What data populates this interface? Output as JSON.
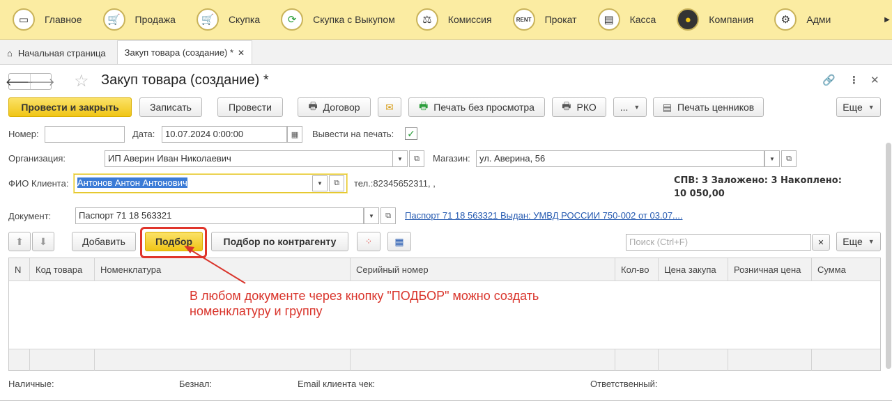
{
  "sections": [
    {
      "label": "Главное",
      "icon": "laptop-icon"
    },
    {
      "label": "Продажа",
      "icon": "cart-icon"
    },
    {
      "label": "Скупка",
      "icon": "cart-icon"
    },
    {
      "label": "Скупка с Выкупом",
      "icon": "cycle-icon"
    },
    {
      "label": "Комиссия",
      "icon": "scales-icon"
    },
    {
      "label": "Прокат",
      "icon": "rent-icon"
    },
    {
      "label": "Касса",
      "icon": "cash-register-icon"
    },
    {
      "label": "Компания",
      "icon": "company-logo-icon"
    },
    {
      "label": "Адми",
      "icon": "gears-icon"
    }
  ],
  "tabs": {
    "home": "Начальная страница",
    "active": "Закуп товара (создание) *"
  },
  "window": {
    "title": "Закуп товара (создание) *"
  },
  "toolbar": {
    "post_close": "Провести и закрыть",
    "save": "Записать",
    "post": "Провести",
    "contract": "Договор",
    "print_no_preview": "Печать без просмотра",
    "rko": "РКО",
    "dots": "...",
    "print_tags": "Печать ценников",
    "more": "Еще"
  },
  "form": {
    "number_label": "Номер:",
    "number_value": "",
    "date_label": "Дата:",
    "date_value": "10.07.2024  0:00:00",
    "print_label": "Вывести на печать:",
    "org_label": "Организация:",
    "org_value": "ИП Аверин Иван Николаевич",
    "store_label": "Магазин:",
    "store_value": "ул. Аверина, 56",
    "client_label": "ФИО Клиента:",
    "client_value": "Антонов Антон Антонович",
    "phone": "тел.:82345652311, ,",
    "spv_line1": "СПВ: 3 Заложено: 3 Накоплено:",
    "spv_line2": "10 050,00",
    "doc_label": "Документ:",
    "doc_value": "Паспорт 71 18 563321",
    "doc_link": "Паспорт 71 18 563321 Выдан: УМВД РОССИИ 750-002 от 03.07...."
  },
  "table_toolbar": {
    "add": "Добавить",
    "pick": "Подбор",
    "pick_by_counterparty": "Подбор по контрагенту",
    "search_placeholder": "Поиск (Ctrl+F)",
    "more": "Еще"
  },
  "table": {
    "columns": [
      "N",
      "Код товара",
      "Номенклатура",
      "Серийный номер",
      "Кол-во",
      "Цена закупа",
      "Розничная цена",
      "Сумма"
    ],
    "rows": []
  },
  "annotation": {
    "line1": "В любом документе через кнопку \"ПОДБОР\" можно создать",
    "line2": "номенклатуру и группу"
  },
  "footer": {
    "cash": "Наличные:",
    "noncash": "Безнал:",
    "email": "Email клиента чек:",
    "responsible": "Ответственный:"
  },
  "colors": {
    "topbar": "#fbeca2",
    "primary_button": "#f0c516",
    "annotation": "#d9342b",
    "link": "#2459b0"
  }
}
